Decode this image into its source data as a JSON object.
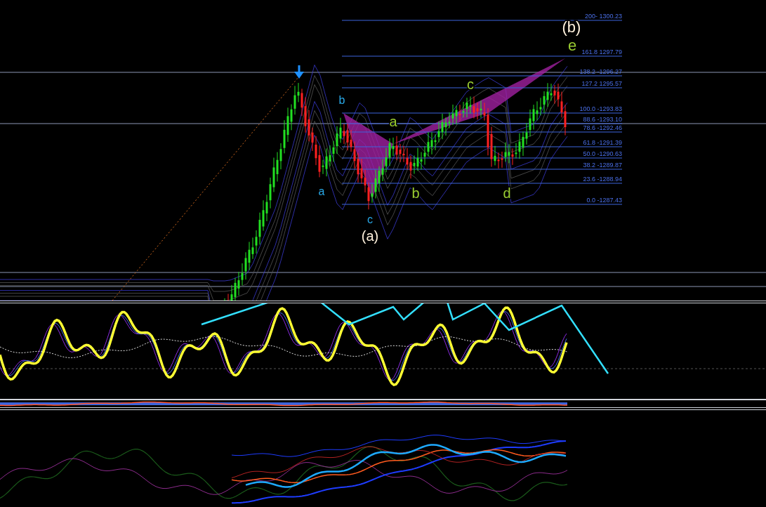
{
  "price_chart": {
    "wave_labels": [
      {
        "text": "(b)",
        "color": "#fff1dc"
      },
      {
        "text": "e",
        "color": "#9acd32"
      },
      {
        "text": "c",
        "color": "#9acd32"
      },
      {
        "text": "b",
        "color": "#29a9e8"
      },
      {
        "text": "a",
        "color": "#9acd32"
      },
      {
        "text": "a",
        "color": "#29a9e8"
      },
      {
        "text": "b",
        "color": "#9acd32"
      },
      {
        "text": "d",
        "color": "#9acd32"
      },
      {
        "text": "c",
        "color": "#29a9e8"
      },
      {
        "text": "(a)",
        "color": "#fff1dc"
      }
    ],
    "fib_levels": [
      {
        "label": "200- 1300.23"
      },
      {
        "label": "161.8 1297.79"
      },
      {
        "label": "138.2 -1296.27"
      },
      {
        "label": "127.2 1295.57"
      },
      {
        "label": "100.0 -1293.83"
      },
      {
        "label": "88.6 -1293.10"
      },
      {
        "label": "78.6 -1292.46"
      },
      {
        "label": "61.8 -1291.39"
      },
      {
        "label": "50.0 -1290.63"
      },
      {
        "label": "38.2 -1289.87"
      },
      {
        "label": "23.6 -1288.94"
      },
      {
        "label": "0.0 -1287.43"
      }
    ]
  }
}
